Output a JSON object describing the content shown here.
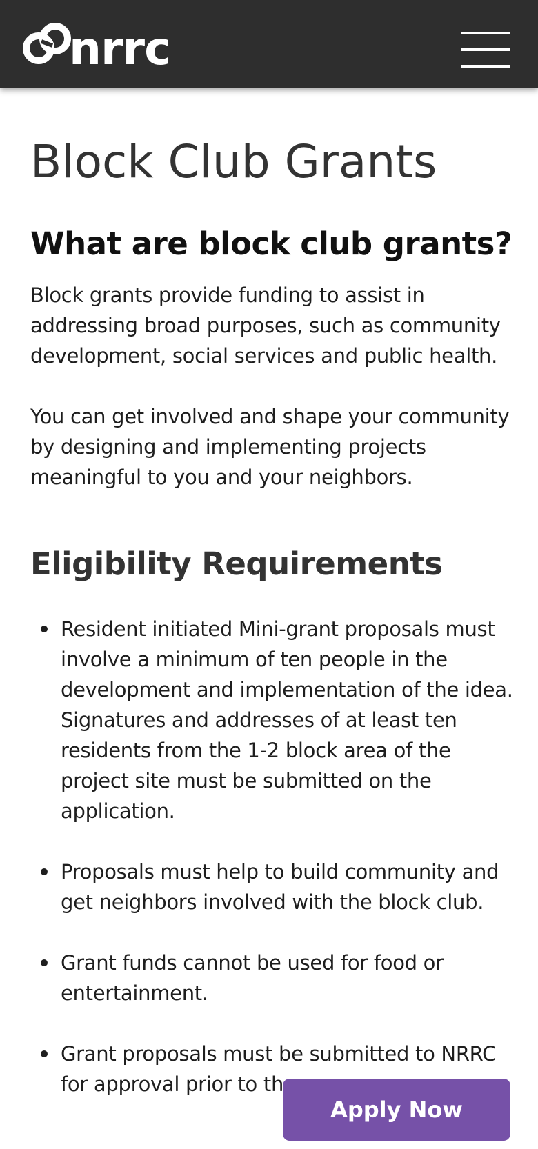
{
  "header": {
    "logo_text": "nrrc",
    "logo_icon": "chain-link-icon",
    "menu_icon": "hamburger-menu-icon",
    "background_color": "#2e2e2e"
  },
  "page": {
    "title": "Block Club Grants"
  },
  "what_section": {
    "heading": "What are block club grants?",
    "paragraphs": [
      "Block grants provide funding to assist in addressing broad purposes, such as community development, social services and public health.",
      "You can get involved and shape your community by designing and implementing projects meaningful to you and your neighbors."
    ]
  },
  "eligibility": {
    "heading": "Eligibility Requirements",
    "items": [
      "Resident initiated Mini-grant proposals must involve a minimum of ten people in the development and implementation of the idea. Signatures and addresses of at least ten residents from the 1-2 block area of the project site must be submitted on the application.",
      "Proposals must help to build community and get neighbors involved with the block club.",
      "Grant funds cannot be used for food or entertainment.",
      "Grant proposals must be submitted to NRRC for approval prior to th"
    ]
  },
  "cta": {
    "apply_label": "Apply Now",
    "color": "#7651a8"
  }
}
